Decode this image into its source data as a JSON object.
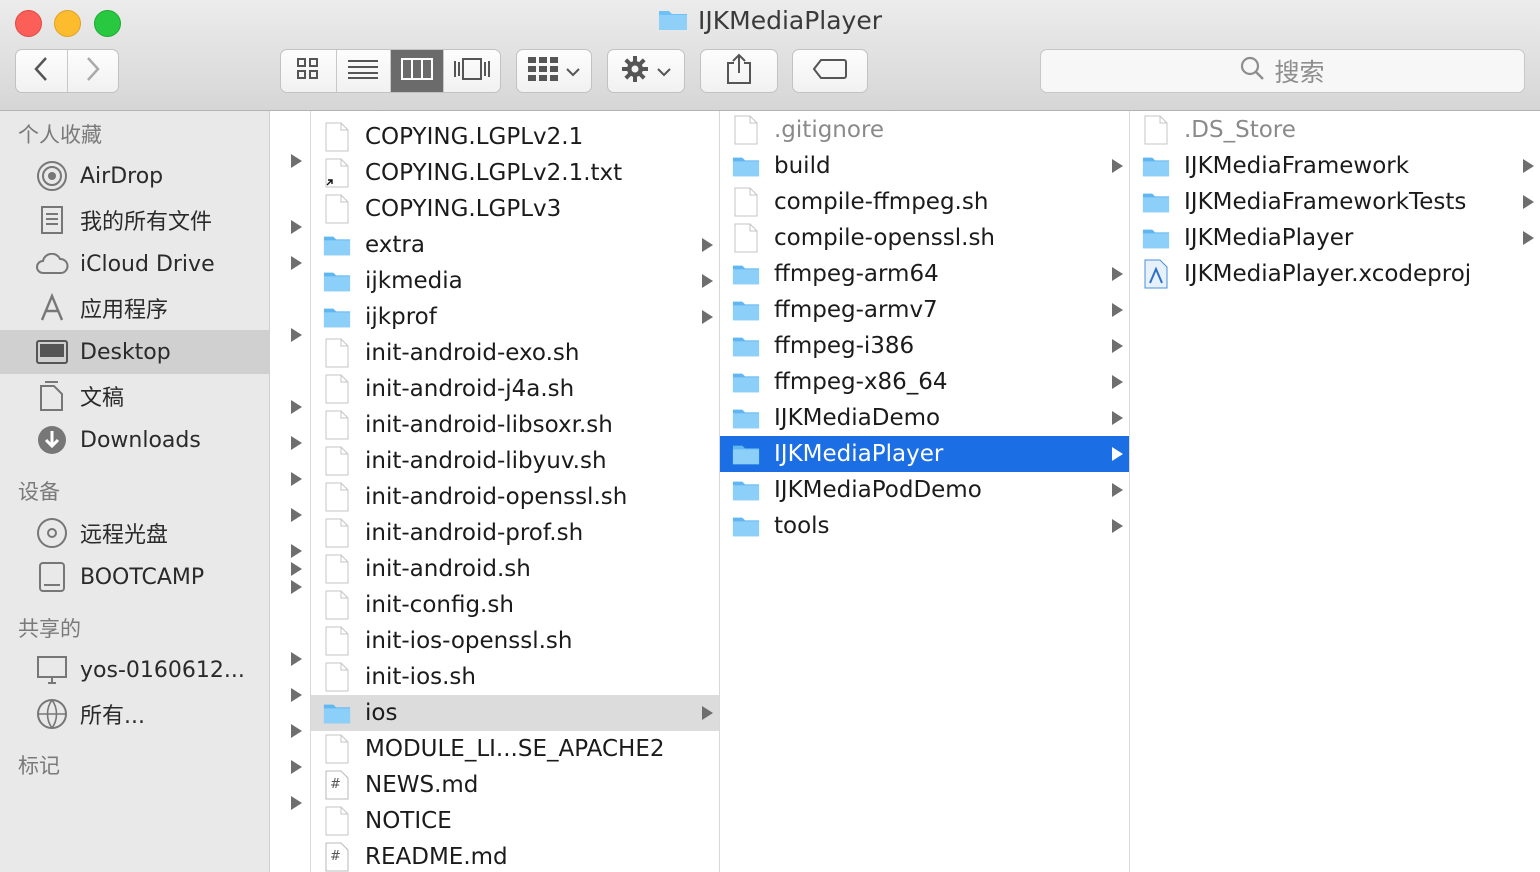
{
  "window": {
    "title": "IJKMediaPlayer"
  },
  "toolbar": {
    "back_icon": "chevron-left-icon",
    "forward_icon": "chevron-right-icon",
    "view_modes": [
      "icon-view",
      "list-view",
      "column-view",
      "coverflow-view"
    ],
    "active_view": "column-view",
    "search_placeholder": "搜索"
  },
  "sidebar": {
    "sections": [
      {
        "label": "个人收藏",
        "items": [
          {
            "label": "AirDrop",
            "icon": "airdrop-icon"
          },
          {
            "label": "我的所有文件",
            "icon": "all-files-icon"
          },
          {
            "label": "iCloud Drive",
            "icon": "cloud-icon"
          },
          {
            "label": "应用程序",
            "icon": "applications-icon"
          },
          {
            "label": "Desktop",
            "icon": "desktop-icon",
            "selected": true
          },
          {
            "label": "文稿",
            "icon": "documents-icon"
          },
          {
            "label": "Downloads",
            "icon": "downloads-icon"
          }
        ]
      },
      {
        "label": "设备",
        "items": [
          {
            "label": "远程光盘",
            "icon": "disc-icon"
          },
          {
            "label": "BOOTCAMP",
            "icon": "drive-icon"
          }
        ]
      },
      {
        "label": "共享的",
        "items": [
          {
            "label": "yos-0160612...",
            "icon": "computer-icon"
          },
          {
            "label": "所有...",
            "icon": "network-icon"
          }
        ]
      },
      {
        "label": "标记",
        "items": []
      }
    ]
  },
  "columns": [
    {
      "items": [
        {
          "label": "COPYING.LGPLv2.1",
          "type": "file"
        },
        {
          "label": "COPYING.LGPLv2.1.txt",
          "type": "alias"
        },
        {
          "label": "COPYING.LGPLv3",
          "type": "file"
        },
        {
          "label": "extra",
          "type": "folder"
        },
        {
          "label": "ijkmedia",
          "type": "folder"
        },
        {
          "label": "ijkprof",
          "type": "folder"
        },
        {
          "label": "init-android-exo.sh",
          "type": "file"
        },
        {
          "label": "init-android-j4a.sh",
          "type": "file"
        },
        {
          "label": "init-android-libsoxr.sh",
          "type": "file"
        },
        {
          "label": "init-android-libyuv.sh",
          "type": "file"
        },
        {
          "label": "init-android-openssl.sh",
          "type": "file"
        },
        {
          "label": "init-android-prof.sh",
          "type": "file"
        },
        {
          "label": "init-android.sh",
          "type": "file"
        },
        {
          "label": "init-config.sh",
          "type": "file"
        },
        {
          "label": "init-ios-openssl.sh",
          "type": "file"
        },
        {
          "label": "init-ios.sh",
          "type": "file"
        },
        {
          "label": "ios",
          "type": "folder",
          "selected": "gray"
        },
        {
          "label": "MODULE_LI...SE_APACHE2",
          "type": "file"
        },
        {
          "label": "NEWS.md",
          "type": "markdown"
        },
        {
          "label": "NOTICE",
          "type": "file"
        },
        {
          "label": "README.md",
          "type": "markdown"
        }
      ]
    },
    {
      "items": [
        {
          "label": ".gitignore",
          "type": "file",
          "dim": true
        },
        {
          "label": "build",
          "type": "folder"
        },
        {
          "label": "compile-ffmpeg.sh",
          "type": "file"
        },
        {
          "label": "compile-openssl.sh",
          "type": "file"
        },
        {
          "label": "ffmpeg-arm64",
          "type": "folder"
        },
        {
          "label": "ffmpeg-armv7",
          "type": "folder"
        },
        {
          "label": "ffmpeg-i386",
          "type": "folder"
        },
        {
          "label": "ffmpeg-x86_64",
          "type": "folder"
        },
        {
          "label": "IJKMediaDemo",
          "type": "folder"
        },
        {
          "label": "IJKMediaPlayer",
          "type": "folder",
          "selected": "blue"
        },
        {
          "label": "IJKMediaPodDemo",
          "type": "folder"
        },
        {
          "label": "tools",
          "type": "folder"
        }
      ]
    },
    {
      "items": [
        {
          "label": ".DS_Store",
          "type": "file",
          "dim": true
        },
        {
          "label": "IJKMediaFramework",
          "type": "folder"
        },
        {
          "label": "IJKMediaFrameworkTests",
          "type": "folder"
        },
        {
          "label": "IJKMediaPlayer",
          "type": "folder"
        },
        {
          "label": "IJKMediaPlayer.xcodeproj",
          "type": "xcodeproj"
        }
      ]
    }
  ],
  "colors": {
    "selection": "#1b6ee3",
    "folder": "#6cc1f6",
    "sidebar": "#e9e9e9"
  }
}
